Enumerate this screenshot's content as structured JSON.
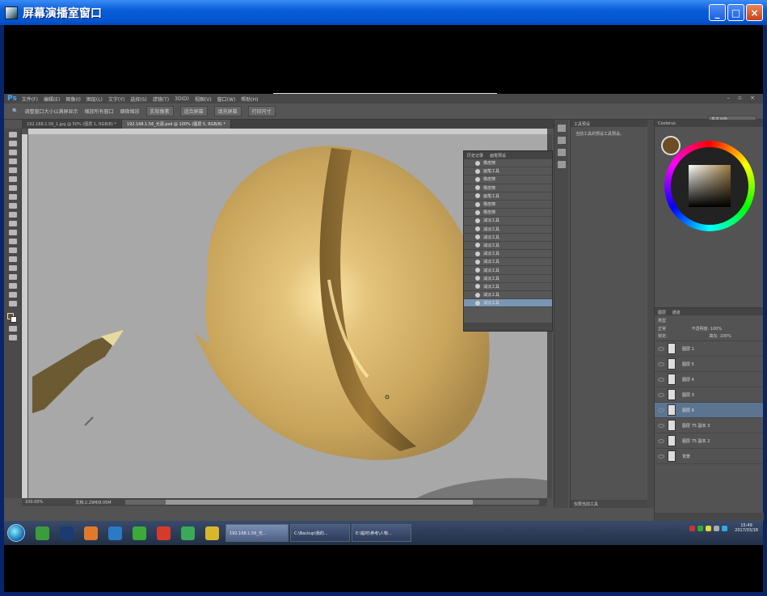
{
  "window": {
    "title": "屏幕演播室窗口"
  },
  "ps": {
    "logo": "Ps",
    "menu": [
      "文件(F)",
      "编辑(E)",
      "图像(I)",
      "图层(L)",
      "文字(Y)",
      "选择(S)",
      "滤镜(T)",
      "3D(D)",
      "视图(V)",
      "窗口(W)",
      "帮助(H)"
    ],
    "window_controls": "– ▫ ×",
    "options": {
      "check1": "调整窗口大小以满屏显示",
      "check2": "缩放所有窗口",
      "check3": "细微缩放",
      "btn1": "实际像素",
      "btn2": "适合屏幕",
      "btn3": "填充屏幕",
      "btn4": "打印尺寸"
    },
    "workspace": "基本功能",
    "tabs": [
      "192.168.1.56_1.jpg @ 50% (图层 1, RGB/8) *",
      "192.168.1.56_光源.psd @ 100% (图层 5, RGB/8) *"
    ],
    "status": {
      "zoom": "100.00%",
      "doc": "文档:2.29M/8.05M"
    },
    "history": {
      "tabs": [
        "历史记录",
        "画笔预设"
      ],
      "items": [
        "橡皮擦",
        "画笔工具",
        "橡皮擦",
        "橡皮擦",
        "画笔工具",
        "橡皮擦",
        "橡皮擦",
        "减淡工具",
        "减淡工具",
        "减淡工具",
        "减淡工具",
        "减淡工具",
        "减淡工具",
        "减淡工具",
        "减淡工具",
        "减淡工具",
        "减淡工具",
        "减淡工具"
      ],
      "selected_index": 17
    },
    "properties": {
      "title": "工具预设",
      "text": "当前工具的预设工具预设。",
      "footer": "仅限当前工具"
    },
    "color": {
      "title": "Coolorus",
      "swatch_color": "#6b4e26"
    },
    "layers": {
      "tabs": [
        "图层",
        "通道"
      ],
      "kind": "类型",
      "blend": "正常",
      "opacity_label": "不透明度:",
      "opacity": "100%",
      "lock_label": "锁定:",
      "fill_label": "填充:",
      "fill": "100%",
      "items": [
        {
          "name": "图层 1",
          "selected": false
        },
        {
          "name": "图层 5",
          "selected": false
        },
        {
          "name": "图层 4",
          "selected": false
        },
        {
          "name": "图层 3",
          "selected": false
        },
        {
          "name": "图层 6",
          "selected": true
        },
        {
          "name": "图层 75 副本 3",
          "selected": false
        },
        {
          "name": "图层 75 副本 2",
          "selected": false
        },
        {
          "name": "背景",
          "selected": false
        }
      ]
    }
  },
  "taskbar": {
    "items": [
      {
        "label": "192.168.1.56_光...",
        "active": true
      },
      {
        "label": "C:\\Backup\\我的...",
        "active": false
      },
      {
        "label": "E:\\临时\\参考\\人物...",
        "active": false
      }
    ],
    "clock_time": "15:49",
    "clock_date": "2017/03/18"
  }
}
